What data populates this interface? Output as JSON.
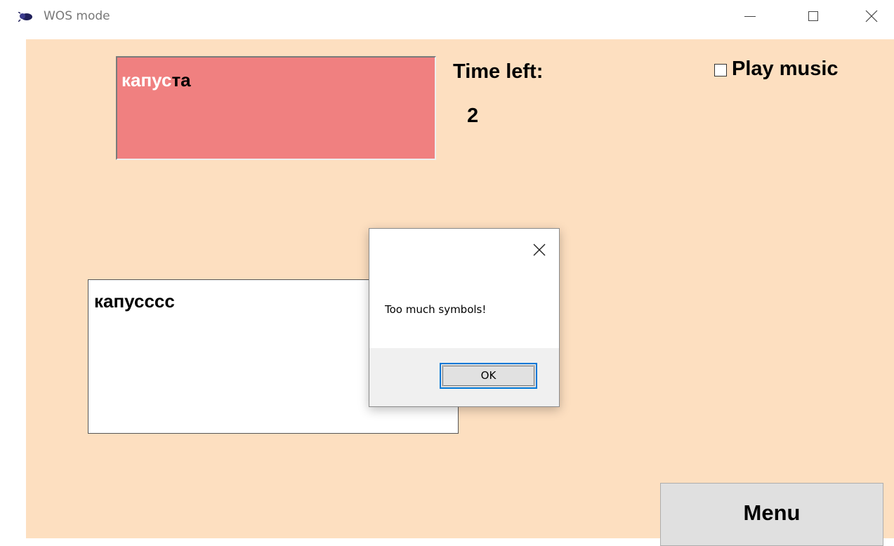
{
  "window": {
    "title": "WOS mode",
    "icon": "app-bug-icon",
    "controls": [
      "minimize-icon",
      "maximize-icon",
      "close-icon"
    ]
  },
  "target": {
    "typed": "капус",
    "remaining": "та",
    "background_color": "#f08080",
    "typed_color": "#ffffff"
  },
  "timer": {
    "label": "Time left:",
    "value": "2"
  },
  "music": {
    "label": "Play music",
    "checked": false
  },
  "input": {
    "value": "капусссс"
  },
  "menu_button": {
    "label": "Menu"
  },
  "dialog": {
    "message": "Too much symbols!",
    "ok_label": "OK",
    "close_icon": "close-icon",
    "accent": "#0078d7"
  },
  "colors": {
    "client_background": "#fddfc0"
  }
}
